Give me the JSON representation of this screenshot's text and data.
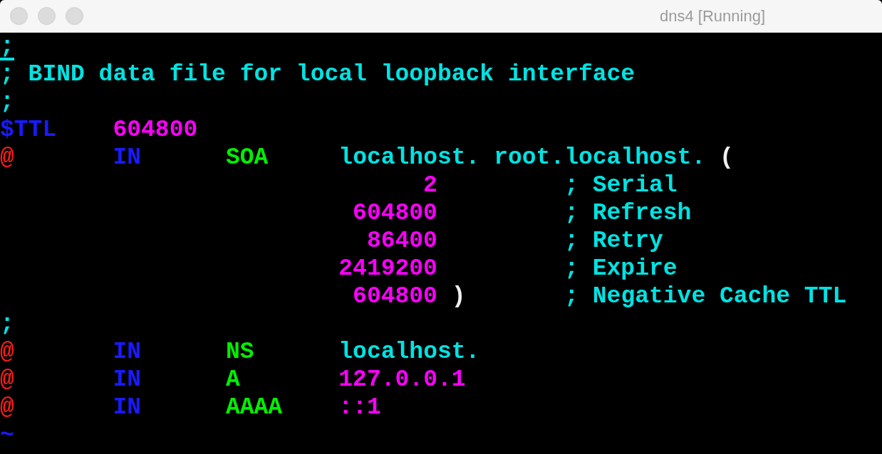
{
  "window": {
    "title": "dns4 [Running]"
  },
  "terminal": {
    "lines": [
      {
        "segments": [
          {
            "kind": "comment",
            "text": ";",
            "cursor": true
          }
        ]
      },
      {
        "segments": [
          {
            "kind": "comment",
            "text": "; BIND data file for local loopback interface",
            "cursor": false
          }
        ]
      },
      {
        "segments": [
          {
            "kind": "comment",
            "text": ";",
            "cursor": false
          }
        ]
      },
      {
        "segments": [
          {
            "kind": "variable",
            "text": "$TTL",
            "cursor": false
          },
          {
            "kind": "number",
            "text": "    604800",
            "cursor": false
          }
        ]
      },
      {
        "segments": [
          {
            "kind": "at",
            "text": "@",
            "cursor": false
          },
          {
            "kind": "class",
            "text": "       IN",
            "cursor": false
          },
          {
            "kind": "type",
            "text": "      SOA",
            "cursor": false
          },
          {
            "kind": "name",
            "text": "     localhost. root.localhost.",
            "cursor": false
          },
          {
            "kind": "paren",
            "text": " (",
            "cursor": false
          }
        ]
      },
      {
        "segments": [
          {
            "kind": "number",
            "text": "                              2",
            "cursor": false
          },
          {
            "kind": "comment",
            "text": "         ; Serial",
            "cursor": false
          }
        ]
      },
      {
        "segments": [
          {
            "kind": "number",
            "text": "                         604800",
            "cursor": false
          },
          {
            "kind": "comment",
            "text": "         ; Refresh",
            "cursor": false
          }
        ]
      },
      {
        "segments": [
          {
            "kind": "number",
            "text": "                          86400",
            "cursor": false
          },
          {
            "kind": "comment",
            "text": "         ; Retry",
            "cursor": false
          }
        ]
      },
      {
        "segments": [
          {
            "kind": "number",
            "text": "                        2419200",
            "cursor": false
          },
          {
            "kind": "comment",
            "text": "         ; Expire",
            "cursor": false
          }
        ]
      },
      {
        "segments": [
          {
            "kind": "number",
            "text": "                         604800",
            "cursor": false
          },
          {
            "kind": "paren",
            "text": " )",
            "cursor": false
          },
          {
            "kind": "comment",
            "text": "       ; Negative Cache TTL",
            "cursor": false
          }
        ]
      },
      {
        "segments": [
          {
            "kind": "comment",
            "text": ";",
            "cursor": false
          }
        ]
      },
      {
        "segments": [
          {
            "kind": "at",
            "text": "@",
            "cursor": false
          },
          {
            "kind": "class",
            "text": "       IN",
            "cursor": false
          },
          {
            "kind": "type",
            "text": "      NS",
            "cursor": false
          },
          {
            "kind": "name",
            "text": "      localhost.",
            "cursor": false
          }
        ]
      },
      {
        "segments": [
          {
            "kind": "at",
            "text": "@",
            "cursor": false
          },
          {
            "kind": "class",
            "text": "       IN",
            "cursor": false
          },
          {
            "kind": "type",
            "text": "      A",
            "cursor": false
          },
          {
            "kind": "number",
            "text": "       127.0.0.1",
            "cursor": false
          }
        ]
      },
      {
        "segments": [
          {
            "kind": "at",
            "text": "@",
            "cursor": false
          },
          {
            "kind": "class",
            "text": "       IN",
            "cursor": false
          },
          {
            "kind": "type",
            "text": "      AAAA",
            "cursor": false
          },
          {
            "kind": "number",
            "text": "    ::1",
            "cursor": false
          }
        ]
      },
      {
        "segments": [
          {
            "kind": "tilde",
            "text": "~",
            "cursor": false
          }
        ]
      }
    ]
  }
}
